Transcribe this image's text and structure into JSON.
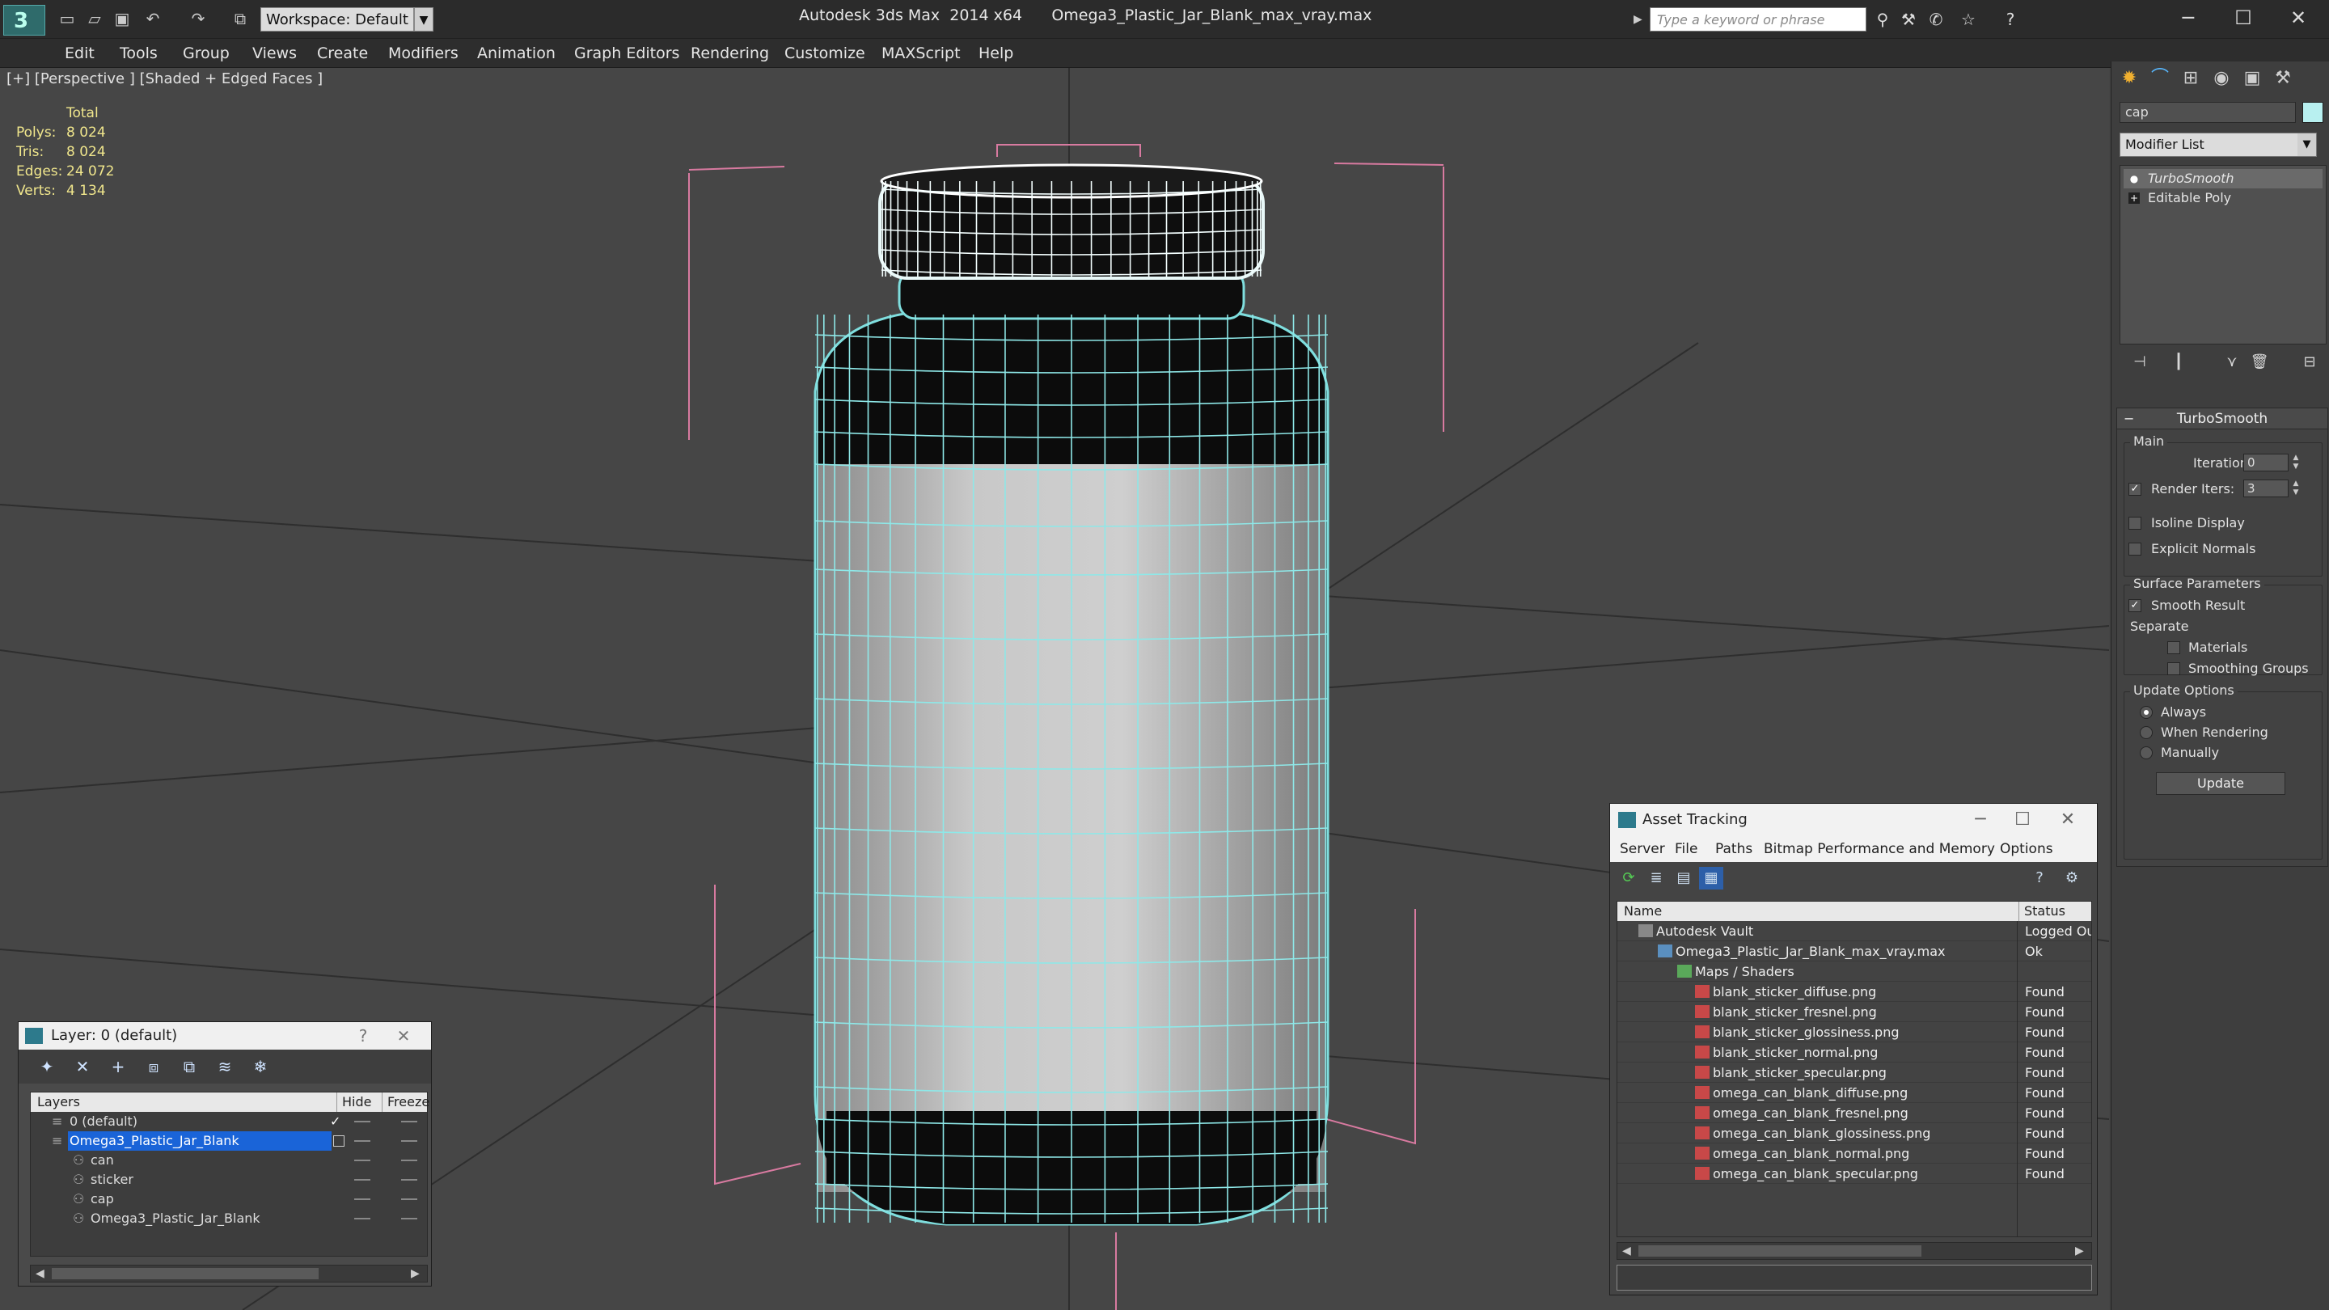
{
  "app": {
    "title": "Autodesk 3ds Max  2014 x64",
    "file": "Omega3_Plastic_Jar_Blank_max_vray.max",
    "workspace": "Workspace: Default",
    "search_placeholder": "Type a keyword or phrase"
  },
  "menu": [
    "Edit",
    "Tools",
    "Group",
    "Views",
    "Create",
    "Modifiers",
    "Animation",
    "Graph Editors",
    "Rendering",
    "Customize",
    "MAXScript",
    "Help"
  ],
  "viewport": {
    "label": "[+] [Perspective ] [Shaded + Edged Faces ]",
    "stats": {
      "header": "Total",
      "rows": [
        {
          "k": "Polys:",
          "v": "8 024"
        },
        {
          "k": "Tris:",
          "v": "8 024"
        },
        {
          "k": "Edges:",
          "v": "24 072"
        },
        {
          "k": "Verts:",
          "v": "4 134"
        }
      ]
    }
  },
  "command_panel": {
    "object_name": "cap",
    "object_color": "#b8f0f0",
    "modifier_list": "Modifier List",
    "stack": [
      "TurboSmooth",
      "Editable Poly"
    ],
    "rollout": {
      "title": "TurboSmooth",
      "main": "Main",
      "iterations_label": "Iterations:",
      "iterations": "0",
      "render_iters_label": "Render Iters:",
      "render_iters": "3",
      "isoline": "Isoline Display",
      "explicit": "Explicit Normals",
      "surface": "Surface Parameters",
      "smooth": "Smooth Result",
      "separate": "Separate",
      "materials": "Materials",
      "smoothing_groups": "Smoothing Groups",
      "update_options": "Update Options",
      "always": "Always",
      "when_rendering": "When Rendering",
      "manually": "Manually",
      "update": "Update"
    }
  },
  "layer_window": {
    "title": "Layer: 0 (default)",
    "help": "?",
    "close": "✕",
    "columns": [
      "Layers",
      "Hide",
      "Freeze"
    ],
    "rows": [
      "0 (default)",
      "Omega3_Plastic_Jar_Blank",
      "can",
      "sticker",
      "cap",
      "Omega3_Plastic_Jar_Blank"
    ]
  },
  "asset_tracking": {
    "title": "Asset Tracking",
    "menu": [
      "Server",
      "File",
      "Paths",
      "Bitmap Performance and Memory",
      "Options"
    ],
    "columns": [
      "Name",
      "Status"
    ],
    "rows": [
      {
        "name": "Autodesk Vault",
        "status": "Logged Ou"
      },
      {
        "name": "Omega3_Plastic_Jar_Blank_max_vray.max",
        "status": "Ok"
      },
      {
        "name": "Maps / Shaders",
        "status": ""
      },
      {
        "name": "blank_sticker_diffuse.png",
        "status": "Found"
      },
      {
        "name": "blank_sticker_fresnel.png",
        "status": "Found"
      },
      {
        "name": "blank_sticker_glossiness.png",
        "status": "Found"
      },
      {
        "name": "blank_sticker_normal.png",
        "status": "Found"
      },
      {
        "name": "blank_sticker_specular.png",
        "status": "Found"
      },
      {
        "name": "omega_can_blank_diffuse.png",
        "status": "Found"
      },
      {
        "name": "omega_can_blank_fresnel.png",
        "status": "Found"
      },
      {
        "name": "omega_can_blank_glossiness.png",
        "status": "Found"
      },
      {
        "name": "omega_can_blank_normal.png",
        "status": "Found"
      },
      {
        "name": "omega_can_blank_specular.png",
        "status": "Found"
      }
    ]
  }
}
